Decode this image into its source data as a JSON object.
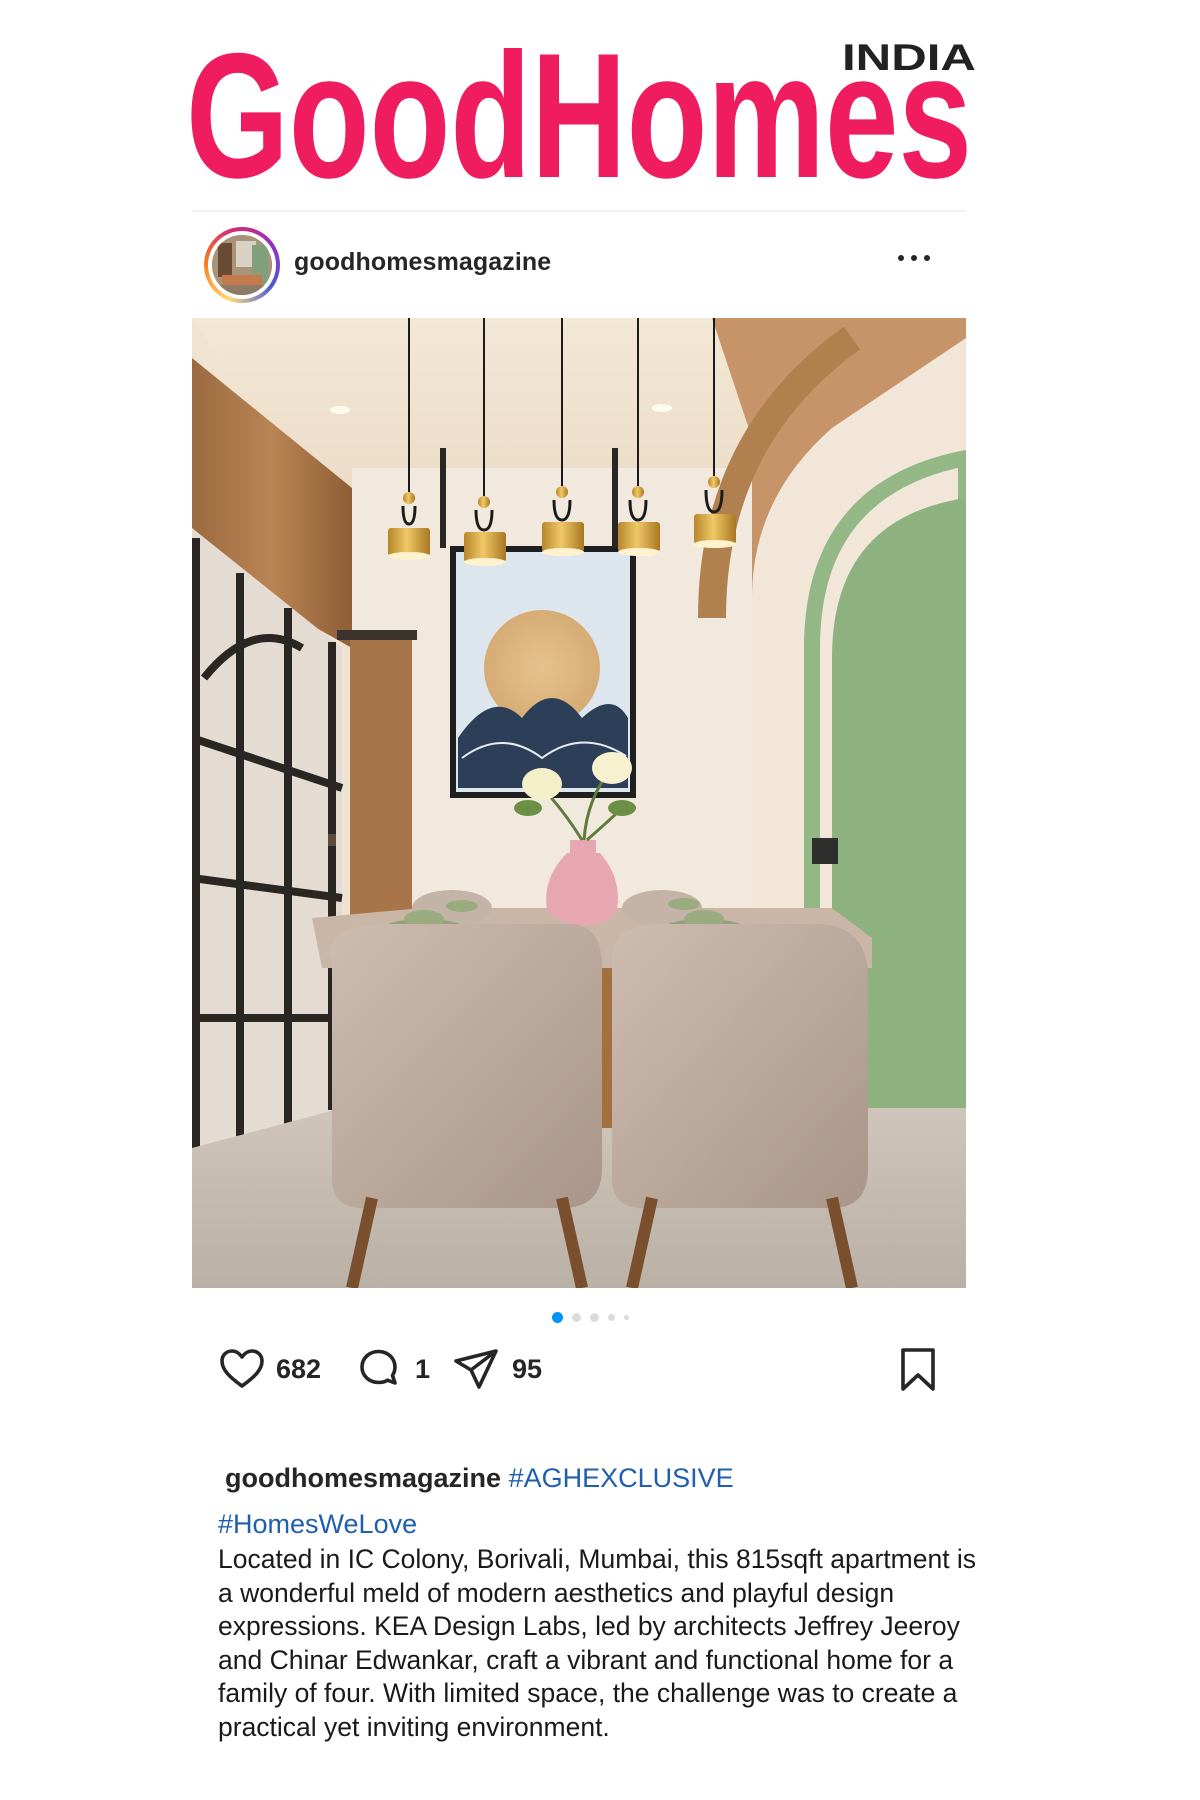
{
  "masthead": {
    "brand": "GoodHomes",
    "edition": "INDIA",
    "brand_color": "#ef1c5f"
  },
  "post": {
    "username": "goodhomesmagazine",
    "more_icon": "more-horizontal-icon",
    "carousel": {
      "total": 5,
      "active": 1
    },
    "actions": {
      "likes": "682",
      "comments": "1",
      "shares": "95",
      "icons": [
        "heart-icon",
        "comment-icon",
        "share-icon",
        "bookmark-icon"
      ]
    },
    "caption": {
      "username": "goodhomesmagazine",
      "hashtag1": "#AGHEXCLUSIVE",
      "hashtag2": "#HomesWeLove",
      "body": "Located in IC Colony, Borivali, Mumbai, this 815sqft apartment is a wonderful meld of modern aesthetics and playful design expressions. KEA Design Labs, led by architects Jeffrey Jeeroy and Chinar Edwankar, craft a vibrant and functional home for a family of four. With limited space, the challenge was to create a practical yet inviting environment."
    }
  },
  "colors": {
    "hashtag": "#1f5fae",
    "carousel_active": "#0095f6",
    "carousel_inactive": "#dbdbdb",
    "text": "#262626"
  }
}
